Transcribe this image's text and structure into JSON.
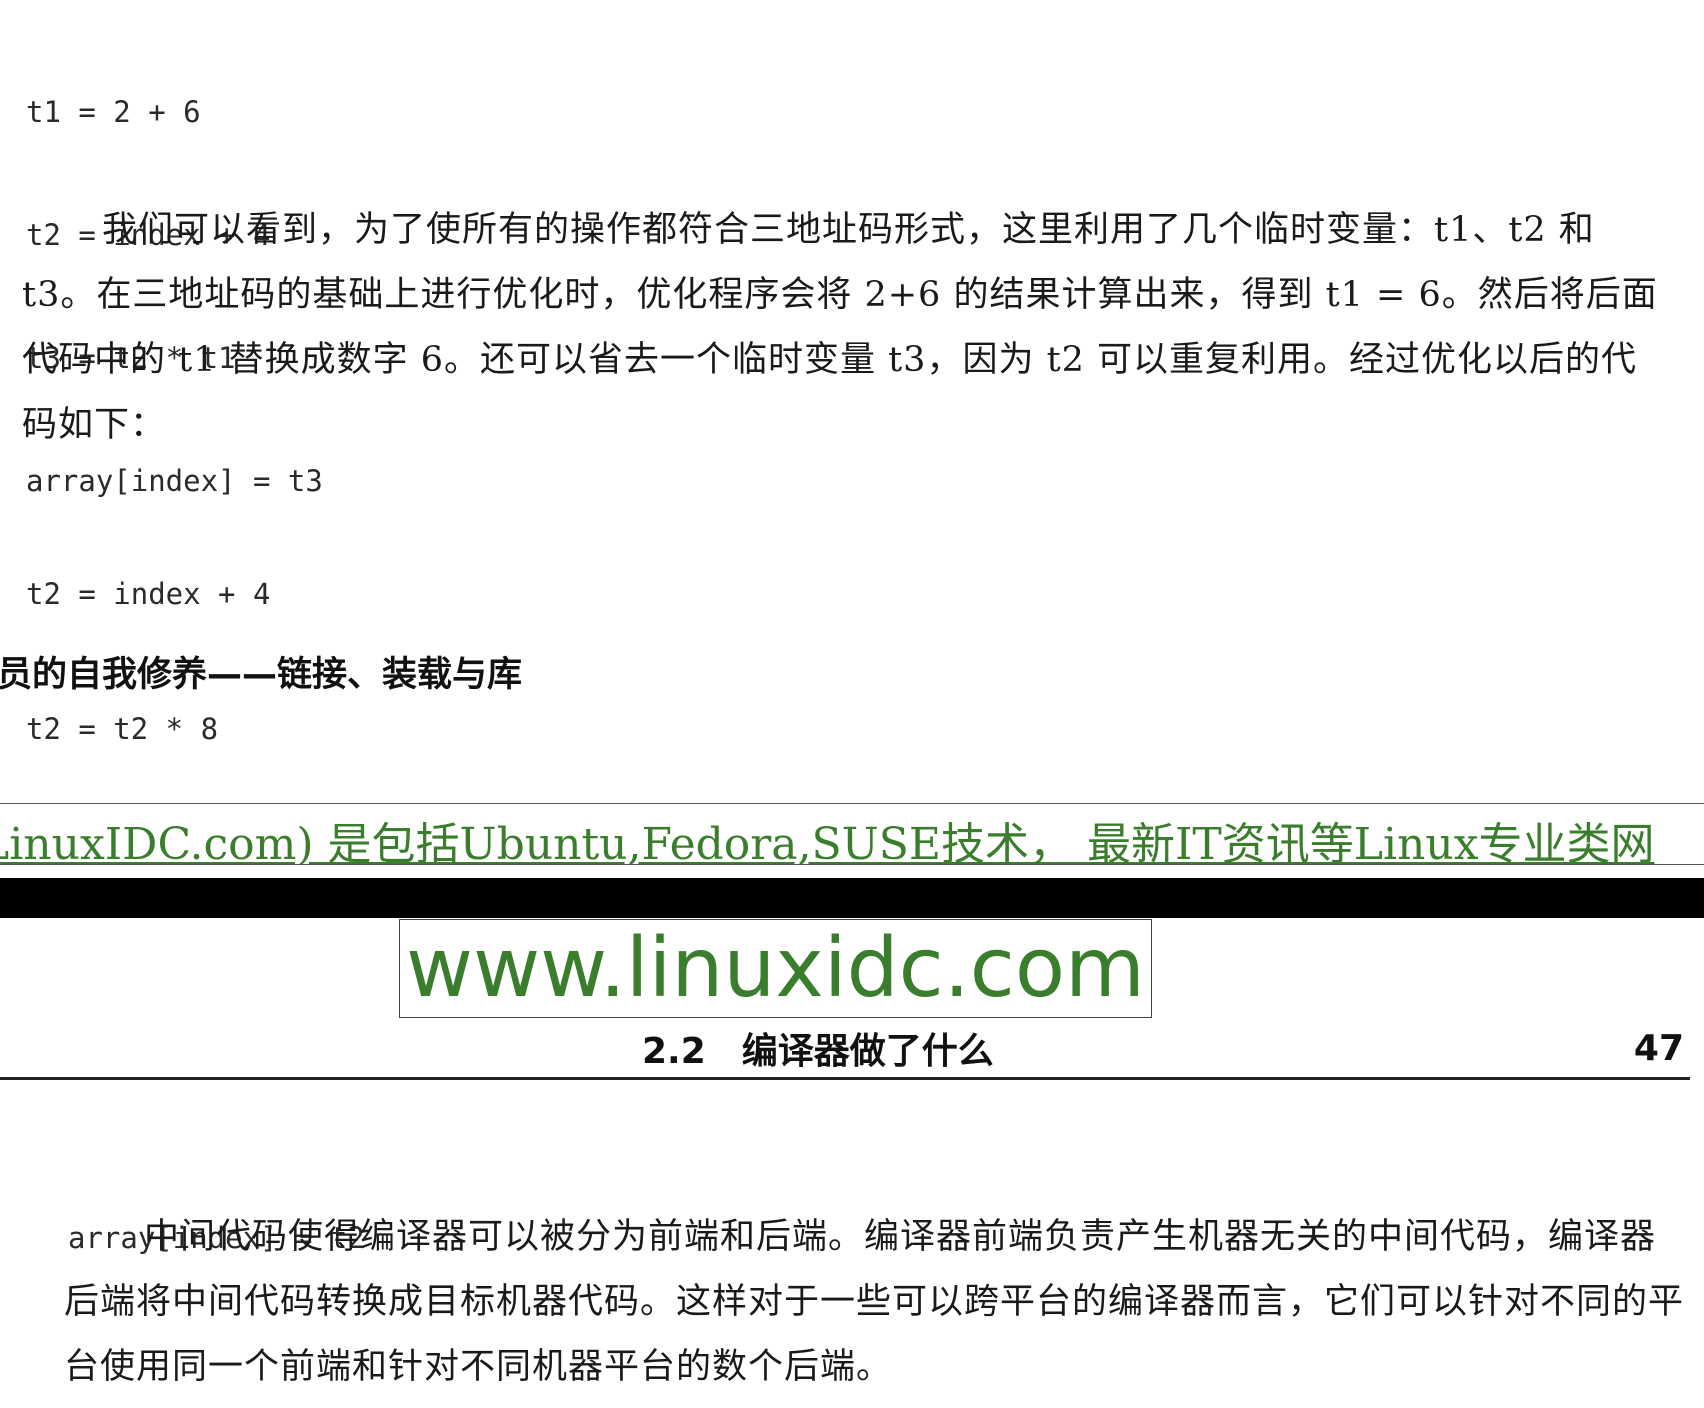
{
  "code_block_1": [
    "t1 = 2 + 6",
    "t2 = index + 4",
    "t3 = t2 * t1",
    "array[index] = t3"
  ],
  "paragraph_1": "我们可以看到，为了使所有的操作都符合三地址码形式，这里利用了几个临时变量：t1、t2 和 t3。在三地址码的基础上进行优化时，优化程序会将 2+6 的结果计算出来，得到 t1 = 6。然后将后面代码中的 t1 替换成数字 6。还可以省去一个临时变量 t3，因为 t2 可以重复利用。经过优化以后的代码如下：",
  "code_block_2": [
    "t2 = index + 4",
    "t2 = t2 * 8"
  ],
  "running_head": "序员的自我修养——链接、装载与库",
  "ad_banner_text": "LinuxIDC.com) 是包括Ubuntu,Fedora,SUSE技术， 最新IT资讯等Linux专业类网",
  "watermark_url": "www.linuxidc.com",
  "section_number": "2.2",
  "section_title": "编译器做了什么",
  "page_number": "47",
  "code_block_3": [
    "array[index] = t2"
  ],
  "paragraph_2": "中间代码使得编译器可以被分为前端和后端。编译器前端负责产生机器无关的中间代码，编译器后端将中间代码转换成目标机器代码。这样对于一些可以跨平台的编译器而言，它们可以针对不同的平台使用同一个前端和针对不同机器平台的数个后端。",
  "colors": {
    "ad_green": "#3a7d2c",
    "bar_black": "#000000"
  }
}
